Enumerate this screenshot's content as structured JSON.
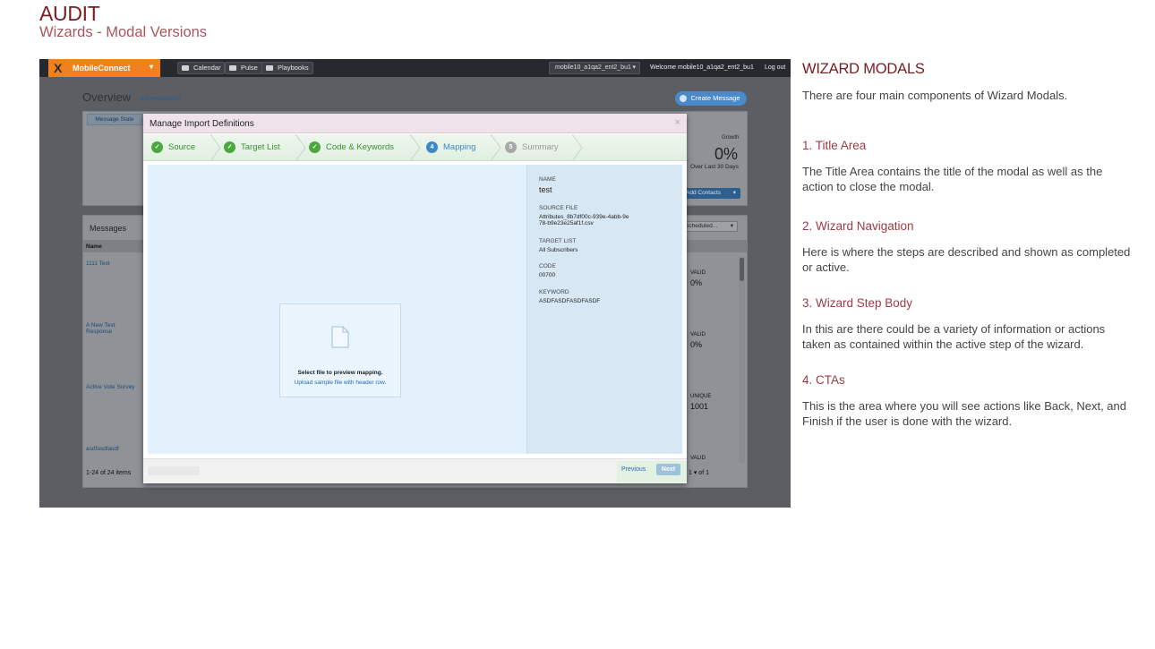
{
  "doc": {
    "title": "AUDIT",
    "subtitle": "Wizards - Modal Versions"
  },
  "app": {
    "brand": "MobileConnect",
    "nav": [
      {
        "label": "Calendar",
        "icon": "calendar-icon"
      },
      {
        "label": "Pulse",
        "icon": "pulse-icon"
      },
      {
        "label": "Playbooks",
        "icon": "playbooks-icon"
      }
    ],
    "account_select": "mobile10_a1qa2_ent2_bu1",
    "welcome": "Welcome  mobile10_a1qa2_ent2_bu1",
    "logout": "Log out",
    "page_title": "Overview",
    "admin_link": "Administration",
    "create_message": "Create Message",
    "message_state_tab": "Message State",
    "growth_label": "Growth",
    "growth_value": "0%",
    "growth_sub": "Over Last 30 Days",
    "add_contacts": "Add Contacts",
    "messages_title": "Messages",
    "scheduled_select": "Scheduled...",
    "name_column": "Name",
    "rows": [
      {
        "name": "1111 Test",
        "metric_label": "VALID",
        "metric_value": "0%"
      },
      {
        "name": "A New Text Response",
        "metric_label": "VALID",
        "metric_value": "0%"
      },
      {
        "name": "Active Vote Survey",
        "metric_label": "UNIQUE",
        "metric_value": "1001"
      },
      {
        "name": "asdfasdfasdf",
        "metric_label": "VALID",
        "metric_value": ""
      }
    ],
    "items_count": "1-24 of 24 items",
    "pager": "1  ▾  of 1"
  },
  "modal": {
    "title": "Manage Import Definitions",
    "close_glyph": "×",
    "steps": [
      {
        "label": "Source",
        "state": "done",
        "mark": "✓"
      },
      {
        "label": "Target List",
        "state": "done",
        "mark": "✓"
      },
      {
        "label": "Code & Keywords",
        "state": "done",
        "mark": "✓"
      },
      {
        "label": "Mapping",
        "state": "active",
        "mark": "4"
      },
      {
        "label": "Summary",
        "state": "todo",
        "mark": "5"
      }
    ],
    "dropzone_text": "Select file to preview mapping.",
    "dropzone_link": "Upload sample file with header row.",
    "info": {
      "name_label": "NAME",
      "name_value": "test",
      "source_label": "SOURCE FILE",
      "source_value": "Attributes_8b7df00c-939e-4abb-9e78-b9e23e25af1f.csv",
      "target_label": "TARGET LIST",
      "target_value": "All Subscribers",
      "code_label": "CODE",
      "code_value": "00700",
      "keyword_label": "KEYWORD",
      "keyword_value": "ASDFASDFASDFASDF"
    },
    "previous": "Previous",
    "next": "Next"
  },
  "side": {
    "title": "WIZARD MODALS",
    "intro": "There are four main components of Wizard Modals.",
    "sections": [
      {
        "heading": "1. Title Area",
        "body": "The Title Area contains the title of the modal as well as the action to close the modal."
      },
      {
        "heading": "2. Wizard Navigation",
        "body": "Here is where the steps are described and shown as completed or active."
      },
      {
        "heading": "3. Wizard Step Body",
        "body": "In this are there could be a variety of information or actions taken as contained within the active step of the wizard."
      },
      {
        "heading": "4. CTAs",
        "body": "This is the area where you will see actions like Back, Next, and Finish if the user is done with the wizard."
      }
    ]
  }
}
